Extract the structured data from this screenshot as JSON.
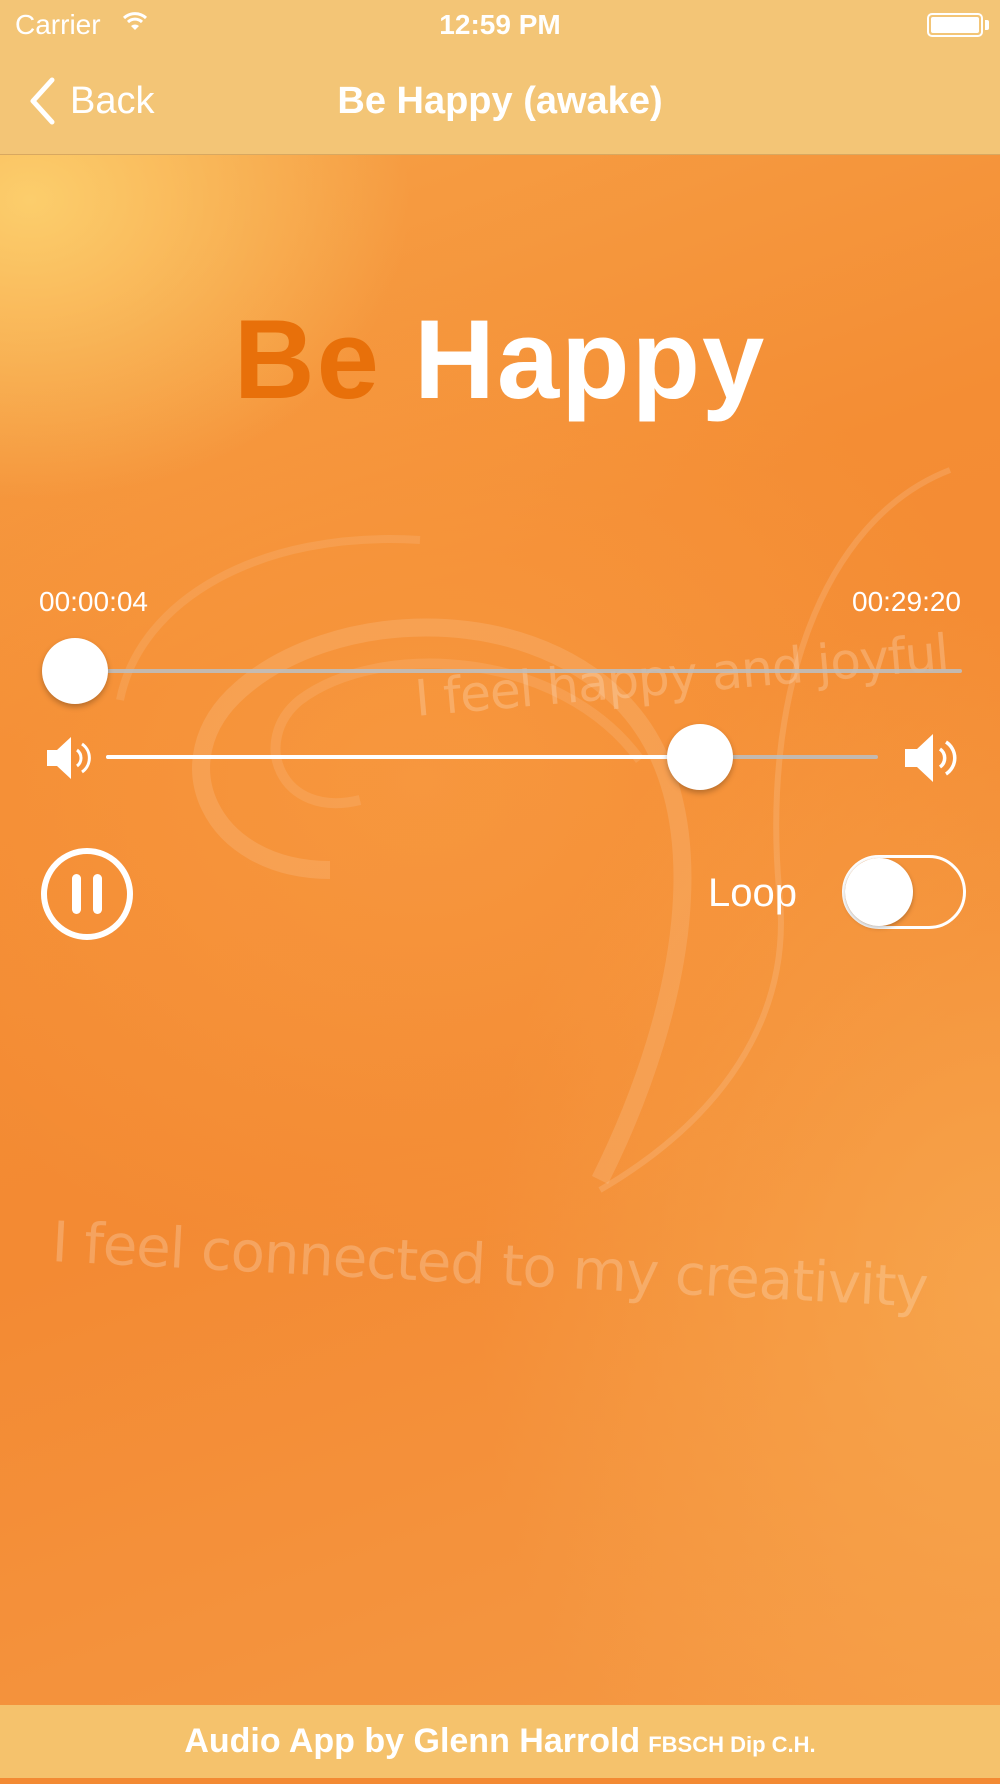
{
  "status_bar": {
    "carrier": "Carrier",
    "time": "12:59 PM",
    "icons": [
      "wifi-icon",
      "battery-icon"
    ]
  },
  "nav": {
    "back_label": "Back",
    "back_icon": "chevron-left-icon",
    "title": "Be Happy (awake)"
  },
  "headline": {
    "word1": "Be",
    "word2": "Happy",
    "word1_color": "#e8700a",
    "word2_color": "#ffffff"
  },
  "player": {
    "elapsed": "00:00:04",
    "total": "00:29:20",
    "progress_fraction": 0.002,
    "volume_fraction": 0.77,
    "volume_min_icon": "speaker-low-icon",
    "volume_max_icon": "speaker-high-icon",
    "play_state_icon": "pause-icon",
    "loop_label": "Loop",
    "loop_on": false
  },
  "background_text": {
    "line1": "I feel happy and joyful",
    "line2": "I feel connected to my creativity"
  },
  "footer": {
    "text": "Audio App by Glenn Harrold",
    "credentials": "FBSCH Dip C.H."
  },
  "colors": {
    "bar": "#f3c576",
    "background": "#f38a33",
    "accent_text": "#e8700a"
  }
}
